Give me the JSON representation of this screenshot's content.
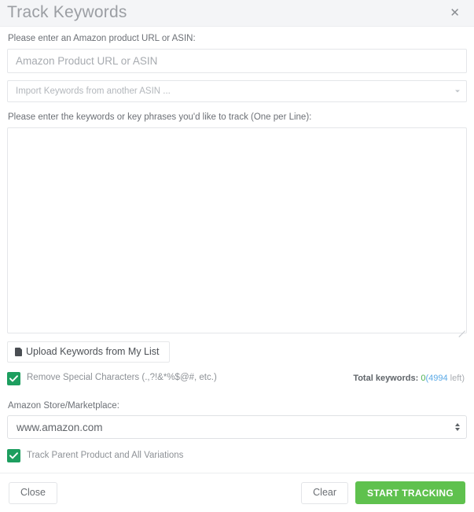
{
  "header": {
    "title": "Track Keywords",
    "close_label": "✕"
  },
  "form": {
    "asin_label": "Please enter an Amazon product URL or ASIN:",
    "asin_placeholder": "Amazon Product URL or ASIN",
    "asin_value": "",
    "import_placeholder": "Import Keywords from another ASIN ...",
    "keywords_label": "Please enter the keywords or key phrases you'd like to track (One per Line):",
    "keywords_value": "",
    "keywords_placeholder": "",
    "upload_button": "Upload Keywords from My List",
    "remove_special_label": "Remove Special Characters (.,?!&*%$@#, etc.)",
    "remove_special_checked": true,
    "total_keywords_label": "Total keywords:",
    "total_keywords_count": "0",
    "total_keywords_open_paren": "(",
    "total_keywords_remaining": "4994",
    "total_keywords_left_word": " left",
    "total_keywords_close_paren": ")",
    "marketplace_label": "Amazon Store/Marketplace:",
    "marketplace_value": "www.amazon.com",
    "track_parent_label": "Track Parent Product and All Variations",
    "track_parent_checked": true
  },
  "footer": {
    "close_button": "Close",
    "clear_button": "Clear",
    "start_tracking_button": "START TRACKING"
  },
  "colors": {
    "accent_green": "#5fc14e",
    "checkbox_green": "#1d9e5f",
    "count_green": "#4caf50",
    "remaining_blue": "#5aa9e6",
    "header_bg": "#f4f5f7"
  }
}
